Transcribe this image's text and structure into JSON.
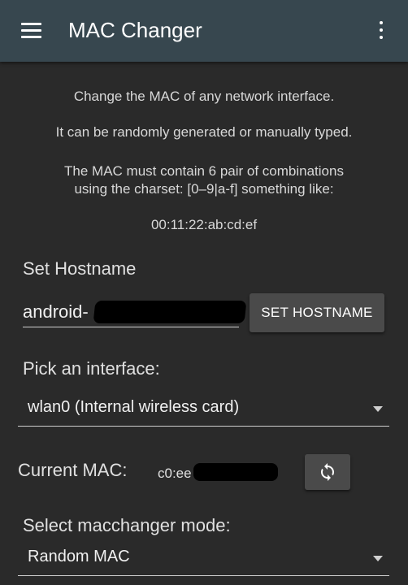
{
  "appbar": {
    "title": "MAC Changer",
    "menu_icon": "hamburger-menu-icon",
    "overflow_icon": "more-vertical-icon",
    "color": "#37474f"
  },
  "info": {
    "line1": "Change the MAC of any network interface.",
    "line2": "It can be randomly generated or manually typed.",
    "line3a": "The MAC must contain 6 pair of combinations",
    "line3b": "using the charset: [0–9|a-f] something like:",
    "example": "00:11:22:ab:cd:ef"
  },
  "hostname": {
    "label": "Set Hostname",
    "value": "android-",
    "button_label": "SET HOSTNAME"
  },
  "interface": {
    "label": "Pick an interface:",
    "selected": "wlan0 (Internal wireless card)"
  },
  "current_mac": {
    "label": "Current MAC:",
    "value": "c0:ee",
    "refresh_icon": "refresh-icon"
  },
  "mode": {
    "label": "Select macchanger mode:",
    "selected": "Random MAC"
  }
}
